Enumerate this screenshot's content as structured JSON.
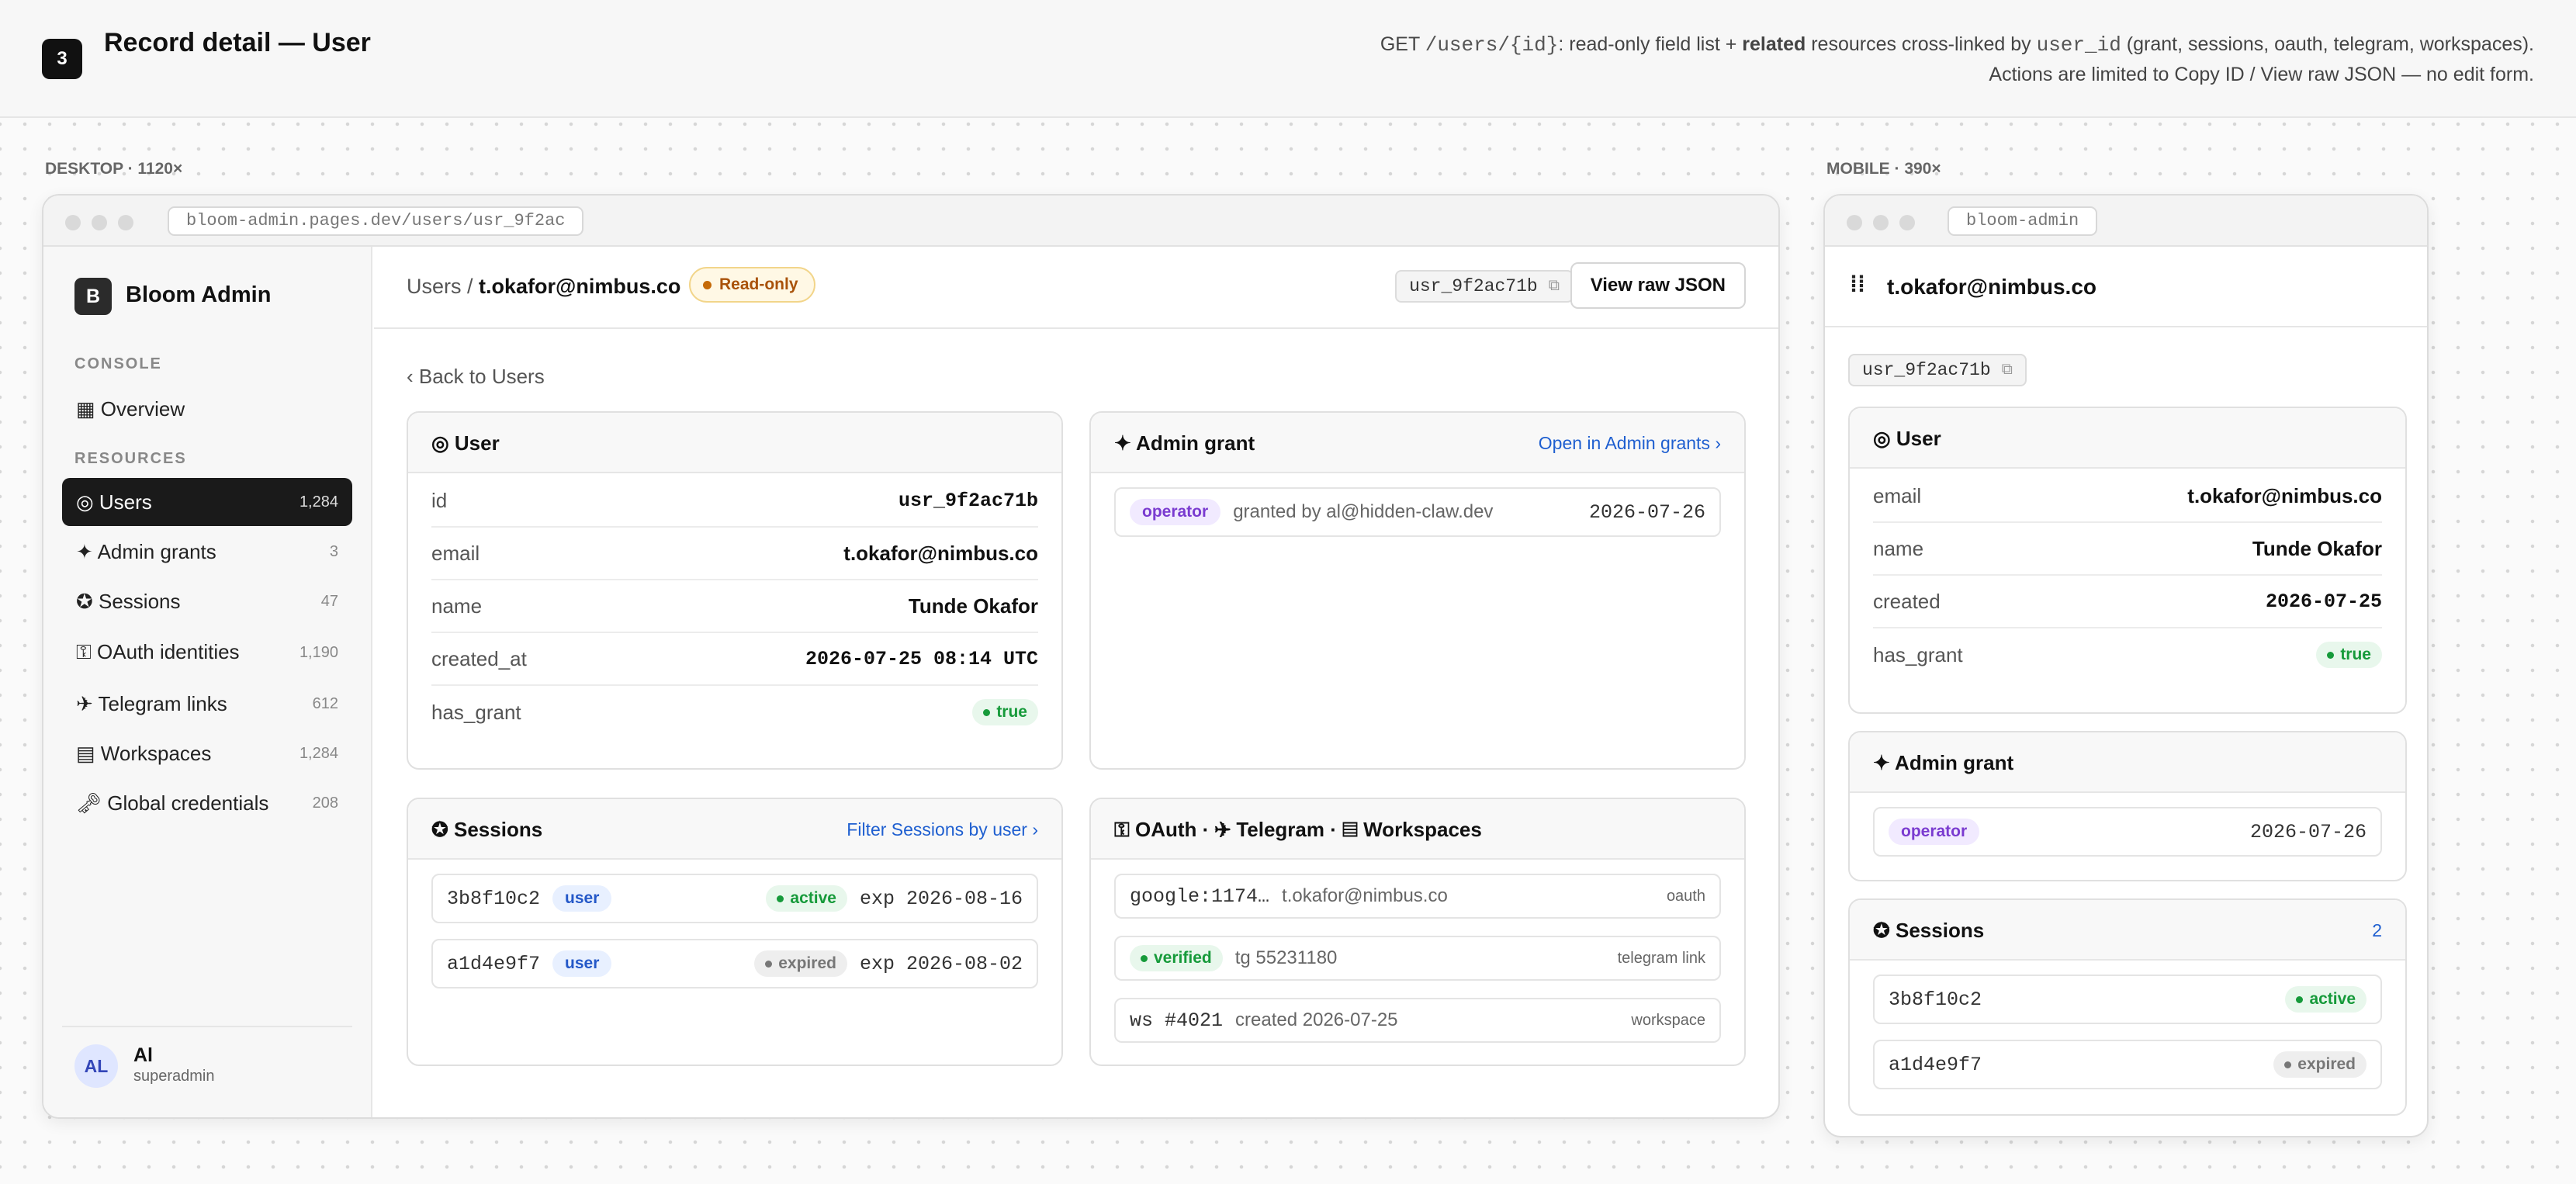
{
  "header": {
    "step": "3",
    "title": "Record detail — User",
    "desc": {
      "p1": "GET ",
      "code1": "/users/{id}",
      "p2": ": read-only field list + ",
      "bold": "related",
      "p3": " resources cross-linked by ",
      "code2": "user_id",
      "p4": " (grant, sessions, oauth, telegram, workspaces). Actions are limited to Copy ID / View raw JSON — no edit form."
    }
  },
  "desktop": {
    "label": "DESKTOP · ",
    "size": "1120×",
    "url": "bloom-admin.pages.dev/users/usr_9f2ac",
    "sidebar": {
      "logo": "B",
      "brand": "Bloom Admin",
      "console_head": "CONSOLE",
      "resources_head": "RESOURCES",
      "overview": "▦ Overview",
      "items": [
        {
          "label": "◎ Users",
          "count": "1,284"
        },
        {
          "label": "✦ Admin grants",
          "count": "3"
        },
        {
          "label": "✪ Sessions",
          "count": "47"
        },
        {
          "label": "⚿ OAuth identities",
          "count": "1,190"
        },
        {
          "label": "✈ Telegram links",
          "count": "612"
        },
        {
          "label": "▤ Workspaces",
          "count": "1,284"
        },
        {
          "label": "🗝 Global credentials",
          "count": "208"
        }
      ],
      "user": {
        "initials": "AL",
        "name": "Al",
        "role": "superadmin"
      }
    },
    "crumb_prefix": "Users / ",
    "crumb_email": "t.okafor@nimbus.co",
    "readonly": "Read-only",
    "id_chip": "usr_9f2ac71b",
    "copy_icon": "⧉",
    "raw_json": "View raw JSON",
    "back": "‹ Back to Users",
    "user_card": {
      "title": "◎ User",
      "fields": [
        {
          "k": "id",
          "v": "usr_9f2ac71b"
        },
        {
          "k": "email",
          "v": "t.okafor@nimbus.co"
        },
        {
          "k": "name",
          "v": "Tunde Okafor"
        },
        {
          "k": "created_at",
          "v": "2026-07-25 08:14 UTC"
        },
        {
          "k": "has_grant",
          "v": "true"
        }
      ]
    },
    "grant_card": {
      "title": "✦ Admin grant",
      "link": "Open in Admin grants ›",
      "role": "operator",
      "by": "granted by al@hidden-claw.dev",
      "date": "2026-07-26"
    },
    "sessions_card": {
      "title": "✪ Sessions",
      "link": "Filter Sessions by user ›",
      "rows": [
        {
          "id": "3b8f10c2",
          "tag": "user",
          "status": "active",
          "exp": "exp 2026-08-16"
        },
        {
          "id": "a1d4e9f7",
          "tag": "user",
          "status": "expired",
          "exp": "exp 2026-08-02"
        }
      ]
    },
    "related_card": {
      "title": "⚿ OAuth · ✈ Telegram · ▤ Workspaces",
      "rows": [
        {
          "a": "google:1174…",
          "b": "t.okafor@nimbus.co",
          "c": "oauth"
        },
        {
          "a": "verified",
          "b": "tg 55231180",
          "c": "telegram link"
        },
        {
          "a": "ws #4021",
          "b": "created 2026-07-25",
          "c": "workspace"
        }
      ]
    }
  },
  "mobile": {
    "label": "MOBILE · ",
    "size": "390×",
    "url": "bloom-admin",
    "menu_icon": "⁞⁞",
    "title": "t.okafor@nimbus.co",
    "id_chip": "usr_9f2ac71b",
    "copy_icon": "⧉",
    "user_card": {
      "title": "◎ User",
      "fields": [
        {
          "k": "email",
          "v": "t.okafor@nimbus.co"
        },
        {
          "k": "name",
          "v": "Tunde Okafor"
        },
        {
          "k": "created",
          "v": "2026-07-25"
        },
        {
          "k": "has_grant",
          "v": "true"
        }
      ]
    },
    "grant_card": {
      "title": "✦ Admin grant",
      "role": "operator",
      "date": "2026-07-26"
    },
    "sessions_card": {
      "title": "✪ Sessions",
      "count": "2",
      "rows": [
        {
          "id": "3b8f10c2",
          "status": "active"
        },
        {
          "id": "a1d4e9f7",
          "status": "expired"
        }
      ]
    }
  }
}
